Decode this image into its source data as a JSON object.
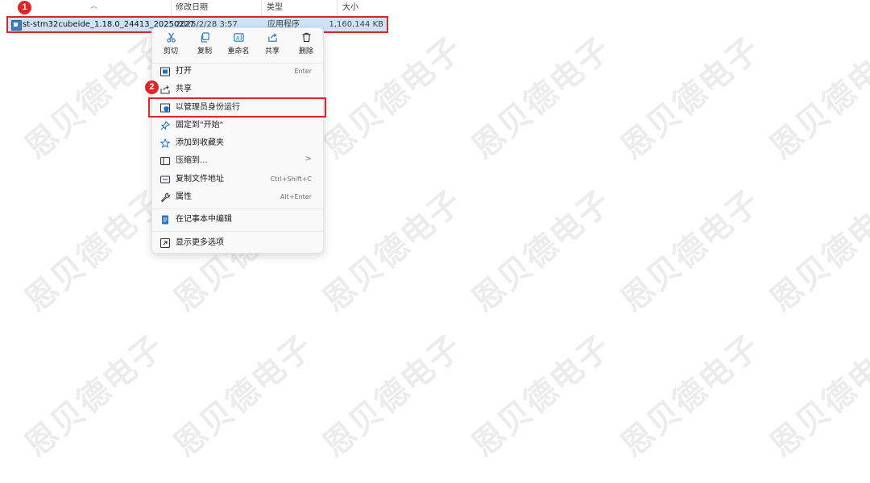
{
  "watermark_text": "恩贝德电子",
  "columns": {
    "date_modified": "修改日期",
    "type": "类型",
    "size": "大小"
  },
  "file": {
    "name": "st-stm32cubeide_1.18.0_24413_20250227",
    "date": "2025/2/28 3:57",
    "type": "应用程序",
    "size": "1,160,144 KB",
    "icon": "installer-icon"
  },
  "badges": {
    "step1": "1",
    "step2": "2"
  },
  "context_menu": {
    "quick_actions": [
      {
        "label": "剪切",
        "icon": "scissors-icon"
      },
      {
        "label": "复制",
        "icon": "copy-icon"
      },
      {
        "label": "重命名",
        "icon": "rename-icon"
      },
      {
        "label": "共享",
        "icon": "share-icon"
      },
      {
        "label": "删除",
        "icon": "trash-icon"
      }
    ],
    "items": [
      {
        "label": "打开",
        "shortcut": "Enter",
        "icon": "open-app-icon"
      },
      {
        "label": "共享",
        "shortcut": "",
        "icon": "share-icon"
      },
      {
        "label": "以管理员身份运行",
        "shortcut": "",
        "icon": "admin-shield-icon"
      },
      {
        "label": "固定到\"开始\"",
        "shortcut": "",
        "icon": "pin-icon"
      },
      {
        "label": "添加到收藏夹",
        "shortcut": "",
        "icon": "star-icon"
      },
      {
        "label": "压缩到...",
        "shortcut": "",
        "icon": "archive-icon",
        "submenu": ">"
      },
      {
        "label": "复制文件地址",
        "shortcut": "Ctrl+Shift+C",
        "icon": "path-icon"
      },
      {
        "label": "属性",
        "shortcut": "Alt+Enter",
        "icon": "wrench-icon"
      },
      {
        "label": "在记事本中编辑",
        "shortcut": "",
        "icon": "notepad-icon"
      },
      {
        "label": "显示更多选项",
        "shortcut": "",
        "icon": "more-options-icon"
      }
    ]
  },
  "colors": {
    "selection": "#cce4f7",
    "highlight_border": "#e0242a",
    "badge": "#e0242a",
    "menu_bg": "#f9f9f9",
    "accent_blue": "#1a73c8"
  }
}
